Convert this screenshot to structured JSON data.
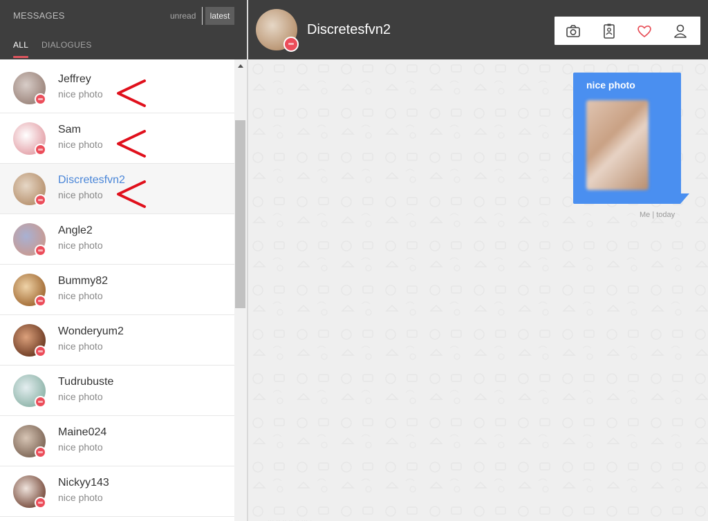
{
  "sidebar": {
    "title": "MESSAGES",
    "filters": {
      "unread": "unread",
      "latest": "latest"
    },
    "tabs": {
      "all": "ALL",
      "dialogues": "DIALOGUES"
    },
    "conversations": [
      {
        "name": "Jeffrey",
        "preview": "nice photo",
        "avatar": [
          "#9c857c",
          "#d8cdc8"
        ],
        "marked": true,
        "active": false
      },
      {
        "name": "Sam",
        "preview": "nice photo",
        "avatar": [
          "#e4a3aa",
          "#ffffff"
        ],
        "marked": true,
        "active": false
      },
      {
        "name": "Discretesfvn2",
        "preview": "nice photo",
        "avatar": [
          "#b89370",
          "#e6d7c6"
        ],
        "marked": true,
        "active": true
      },
      {
        "name": "Angle2",
        "preview": "nice photo",
        "avatar": [
          "#c89a92",
          "#a8b1d3"
        ],
        "marked": false,
        "active": false
      },
      {
        "name": "Bummy82",
        "preview": "nice photo",
        "avatar": [
          "#a26b34",
          "#efd3a8"
        ],
        "marked": false,
        "active": false
      },
      {
        "name": "Wonderyum2",
        "preview": "nice photo",
        "avatar": [
          "#6e3c24",
          "#dca17c"
        ],
        "marked": false,
        "active": false
      },
      {
        "name": "Tudrubuste",
        "preview": "nice photo",
        "avatar": [
          "#8fb5aa",
          "#e4eef0"
        ],
        "marked": false,
        "active": false
      },
      {
        "name": "Maine024",
        "preview": "nice photo",
        "avatar": [
          "#7e6757",
          "#d7c5b5"
        ],
        "marked": false,
        "active": false
      },
      {
        "name": "Nickyy143",
        "preview": "nice photo",
        "avatar": [
          "#7a4f40",
          "#efe3dc"
        ],
        "marked": false,
        "active": false
      }
    ]
  },
  "chat": {
    "contact_name": "Discretesfvn2",
    "actions": [
      "camera-icon",
      "contact-card-icon",
      "heart-icon",
      "profile-icon"
    ],
    "message": {
      "text": "nice photo",
      "meta": "Me | today"
    },
    "bottom_hint": "... ..  .. .. ..  ... ."
  },
  "colors": {
    "header_bg": "#3e3e3e",
    "accent_red": "#e0555e",
    "bubble_blue": "#4a8ff0",
    "active_name": "#4a86d8",
    "annotation_red": "#e0101c",
    "heart": "#e74c55"
  }
}
